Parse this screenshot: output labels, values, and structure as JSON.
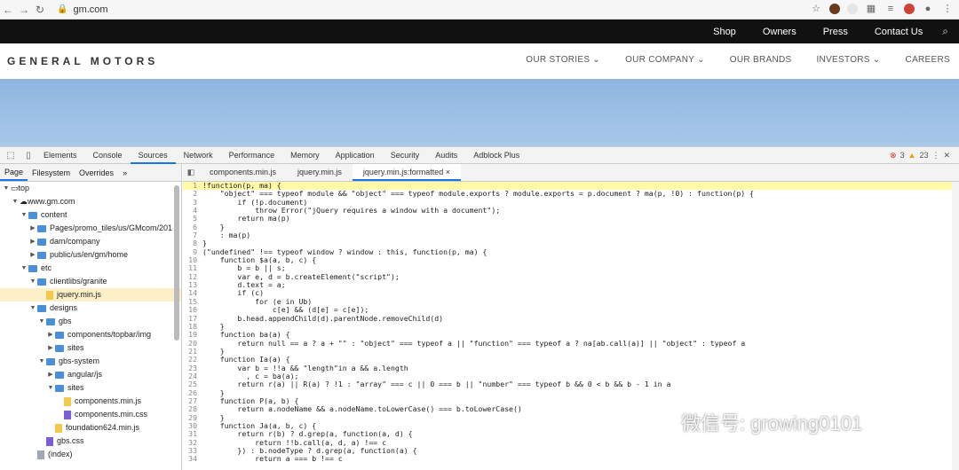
{
  "browser": {
    "url": "gm.com"
  },
  "topnav": {
    "items": [
      "Shop",
      "Owners",
      "Press",
      "Contact Us"
    ]
  },
  "mainnav": {
    "logo": "GENERAL MOTORS",
    "items": [
      "OUR STORIES ⌄",
      "OUR COMPANY ⌄",
      "OUR BRANDS",
      "INVESTORS ⌄",
      "CAREERS"
    ]
  },
  "devtools": {
    "tabs": [
      "Elements",
      "Console",
      "Sources",
      "Network",
      "Performance",
      "Memory",
      "Application",
      "Security",
      "Audits",
      "Adblock Plus"
    ],
    "active_tab": "Sources",
    "errors": "3",
    "warnings": "23",
    "left_tabs": [
      "Page",
      "Filesystem",
      "Overrides",
      "»"
    ],
    "tree": [
      {
        "label": "top",
        "depth": 0,
        "icon": "frame"
      },
      {
        "label": "www.gm.com",
        "depth": 1,
        "icon": "cloud"
      },
      {
        "label": "content",
        "depth": 2,
        "icon": "folder"
      },
      {
        "label": "Pages/promo_tiles/us/GMcom/201",
        "depth": 3,
        "icon": "folder"
      },
      {
        "label": "dam/company",
        "depth": 3,
        "icon": "folder"
      },
      {
        "label": "public/us/en/gm/home",
        "depth": 3,
        "icon": "folder"
      },
      {
        "label": "etc",
        "depth": 2,
        "icon": "folder"
      },
      {
        "label": "clientlibs/granite",
        "depth": 3,
        "icon": "folder"
      },
      {
        "label": "jquery.min.js",
        "depth": 4,
        "icon": "js"
      },
      {
        "label": "designs",
        "depth": 3,
        "icon": "folder"
      },
      {
        "label": "gbs",
        "depth": 4,
        "icon": "folder"
      },
      {
        "label": "components/topbar/img",
        "depth": 5,
        "icon": "folder"
      },
      {
        "label": "sites",
        "depth": 5,
        "icon": "folder"
      },
      {
        "label": "gbs-system",
        "depth": 4,
        "icon": "folder"
      },
      {
        "label": "angular/js",
        "depth": 5,
        "icon": "folder"
      },
      {
        "label": "sites",
        "depth": 5,
        "icon": "folder"
      },
      {
        "label": "components.min.js",
        "depth": 6,
        "icon": "js"
      },
      {
        "label": "components.min.css",
        "depth": 6,
        "icon": "css"
      },
      {
        "label": "foundation624.min.js",
        "depth": 5,
        "icon": "js"
      },
      {
        "label": "gbs.css",
        "depth": 4,
        "icon": "css"
      },
      {
        "label": "(index)",
        "depth": 3,
        "icon": "doc"
      }
    ],
    "editor_tabs": [
      "components.min.js",
      "jquery.min.js",
      "jquery.min.js:formatted ×"
    ],
    "code": [
      "!function(p, ma) {",
      "    \"object\" === typeof module && \"object\" === typeof module.exports ? module.exports = p.document ? ma(p, !0) : function(p) {",
      "        if (!p.document)",
      "            throw Error(\"jQuery requires a window with a document\");",
      "        return ma(p)",
      "    }",
      "    : ma(p)",
      "}",
      "(\"undefined\" !== typeof window ? window : this, function(p, ma) {",
      "    function $a(a, b, c) {",
      "        b = b || s;",
      "        var e, d = b.createElement(\"script\");",
      "        d.text = a;",
      "        if (c)",
      "            for (e in Ub)",
      "                c[e] && (d[e] = c[e]);",
      "        b.head.appendChild(d).parentNode.removeChild(d)",
      "    }",
      "    function ba(a) {",
      "        return null == a ? a + \"\" : \"object\" === typeof a || \"function\" === typeof a ? na[ab.call(a)] || \"object\" : typeof a",
      "    }",
      "    function Ia(a) {",
      "        var b = !!a && \"length\"in a && a.length",
      "          , c = ba(a);",
      "        return r(a) || R(a) ? !1 : \"array\" === c || 0 === b || \"number\" === typeof b && 0 < b && b - 1 in a",
      "    }",
      "    function P(a, b) {",
      "        return a.nodeName && a.nodeName.toLowerCase() === b.toLowerCase()",
      "    }",
      "    function Ja(a, b, c) {",
      "        return r(b) ? d.grep(a, function(a, d) {",
      "            return !!b.call(a, d, a) !== c",
      "        }) : b.nodeType ? d.grep(a, function(a) {",
      "            return a === b !== c"
    ]
  },
  "watermark": "微信号: growing0101"
}
